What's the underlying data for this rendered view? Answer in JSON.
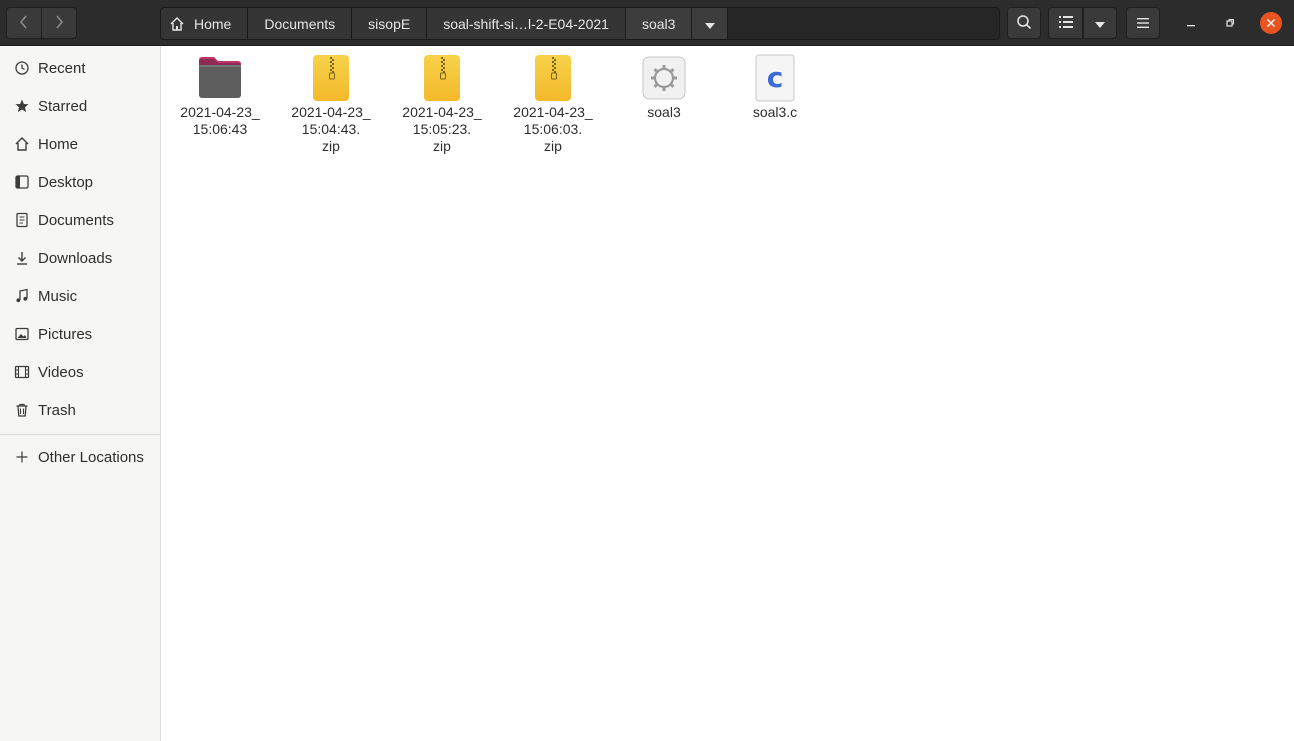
{
  "header": {
    "breadcrumbs": [
      "Home",
      "Documents",
      "sisopE",
      "soal-shift-si…l-2-E04-2021",
      "soal3"
    ],
    "nav": {
      "back_icon": "chevron-left-icon",
      "forward_icon": "chevron-right-icon"
    },
    "buttons": {
      "search_icon": "search-icon",
      "view_icon": "list-view-icon",
      "view_menu_icon": "chevron-down-icon",
      "menu_icon": "hamburger-menu-icon"
    },
    "window": {
      "close_color": "#e95420"
    }
  },
  "sidebar": {
    "items": [
      {
        "label": "Recent",
        "icon": "clock-icon"
      },
      {
        "label": "Starred",
        "icon": "star-icon"
      },
      {
        "label": "Home",
        "icon": "home-icon"
      },
      {
        "label": "Desktop",
        "icon": "desktop-icon"
      },
      {
        "label": "Documents",
        "icon": "document-icon"
      },
      {
        "label": "Downloads",
        "icon": "download-icon"
      },
      {
        "label": "Music",
        "icon": "music-icon"
      },
      {
        "label": "Pictures",
        "icon": "pictures-icon"
      },
      {
        "label": "Videos",
        "icon": "video-icon"
      },
      {
        "label": "Trash",
        "icon": "trash-icon"
      }
    ],
    "other": {
      "label": "Other Locations",
      "icon": "plus-icon"
    }
  },
  "files": [
    {
      "name": "2021-04-23_\n15:06:43",
      "type": "folder",
      "icon": "folder-icon"
    },
    {
      "name": "2021-04-23_\n15:04:43.\nzip",
      "type": "zip",
      "icon": "zip-archive-icon"
    },
    {
      "name": "2021-04-23_\n15:05:23.\nzip",
      "type": "zip",
      "icon": "zip-archive-icon"
    },
    {
      "name": "2021-04-23_\n15:06:03.\nzip",
      "type": "zip",
      "icon": "zip-archive-icon"
    },
    {
      "name": "soal3",
      "type": "executable",
      "icon": "executable-gear-icon"
    },
    {
      "name": "soal3.c",
      "type": "c-source",
      "icon": "c-source-file-icon"
    }
  ]
}
